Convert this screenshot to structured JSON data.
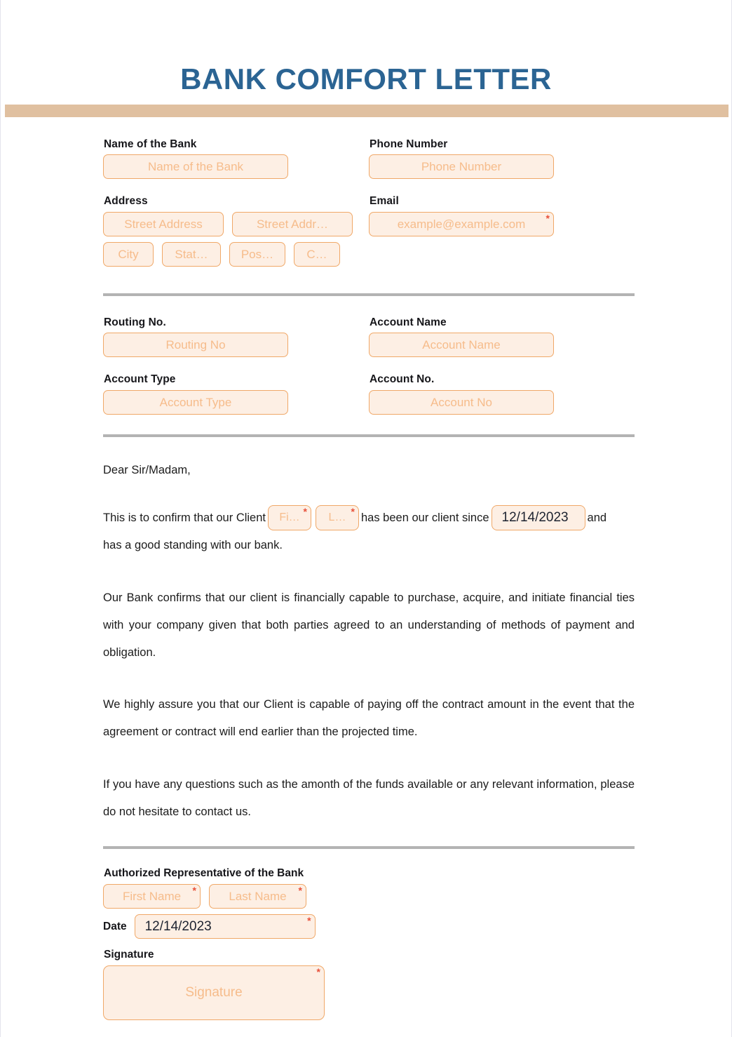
{
  "document": {
    "title": "BANK COMFORT LETTER"
  },
  "bank_section": {
    "bank_name": {
      "label": "Name of the Bank",
      "placeholder": "Name of the Bank",
      "value": ""
    },
    "phone": {
      "label": "Phone Number",
      "placeholder": "Phone Number",
      "value": ""
    },
    "address": {
      "label": "Address",
      "street1_placeholder": "Street Address",
      "street2_placeholder": "Street Addr…",
      "city_placeholder": "City",
      "state_placeholder": "Stat…",
      "postal_placeholder": "Pos…",
      "country_placeholder": "C…"
    },
    "email": {
      "label": "Email",
      "placeholder": "example@example.com",
      "value": "",
      "required_marker": "*"
    }
  },
  "account_section": {
    "routing_no": {
      "label": "Routing No.",
      "placeholder": "Routing No",
      "value": ""
    },
    "account_name": {
      "label": "Account Name",
      "placeholder": "Account Name",
      "value": ""
    },
    "account_type": {
      "label": "Account Type",
      "placeholder": "Account Type",
      "value": ""
    },
    "account_no": {
      "label": "Account No.",
      "placeholder": "Account No",
      "value": ""
    }
  },
  "letter": {
    "salutation": "Dear Sir/Madam,",
    "confirm_prefix": "This is to confirm that our Client",
    "client_first_placeholder": "Fi…",
    "client_last_placeholder": "L…",
    "confirm_middle": "has been our client since",
    "client_since_value": "12/14/2023",
    "confirm_suffix": "and",
    "confirm_line2": "has a good standing with our bank.",
    "paragraph_2": "Our Bank confirms that our client is financially capable to purchase, acquire, and initiate financial ties with your company given that both parties agreed to an understanding of methods of payment and obligation.",
    "paragraph_3": "We highly assure you that our Client is capable of paying off the contract amount in the event that the agreement or contract will end earlier than the projected time.",
    "paragraph_4": "If you have any questions such as the amonth of the funds available or any relevant information, please do not hesitate to contact us.",
    "required_marker": "*"
  },
  "signature_section": {
    "heading": "Authorized Representative of the Bank",
    "first_name_placeholder": "First Name",
    "last_name_placeholder": "Last Name",
    "date_label": "Date",
    "date_value": "12/14/2023",
    "signature_label": "Signature",
    "signature_placeholder": "Signature",
    "required_marker": "*"
  },
  "colors": {
    "title_blue": "#2b6493",
    "band_tan": "#e0c0a0",
    "field_border": "#f0a868",
    "field_fill": "#fdefe4",
    "placeholder_text": "#f6bc8b",
    "required_red": "#e8503a",
    "divider_gray": "#b3b3b3",
    "body_text": "#1c1c1c"
  }
}
